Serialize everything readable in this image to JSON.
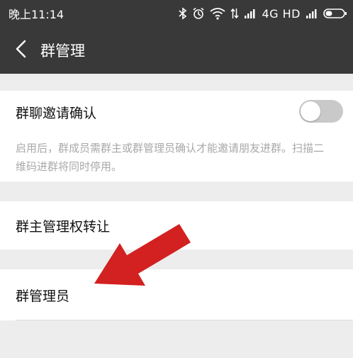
{
  "status_bar": {
    "time": "晚上11:14",
    "network_label": "4G HD",
    "icons": [
      "bluetooth-icon",
      "alarm-icon",
      "wifi-icon",
      "data-arrows-icon",
      "signal-icon",
      "signal-icon",
      "battery-icon"
    ]
  },
  "header": {
    "back_icon": "chevron-left-icon",
    "title": "群管理"
  },
  "settings": {
    "invite_confirm": {
      "label": "群聊邀请确认",
      "toggle_on": false,
      "description": "启用后，群成员需群主或群管理员确认才能邀请朋友进群。扫描二维码进群将同时停用。"
    },
    "transfer_owner": {
      "label": "群主管理权转让"
    },
    "group_admins": {
      "label": "群管理员"
    }
  },
  "annotation": {
    "icon": "red-arrow-icon",
    "color": "#d32020"
  },
  "colors": {
    "header_bg": "#393939",
    "page_bg": "#ededed",
    "toggle_off": "#c9c9c9"
  }
}
